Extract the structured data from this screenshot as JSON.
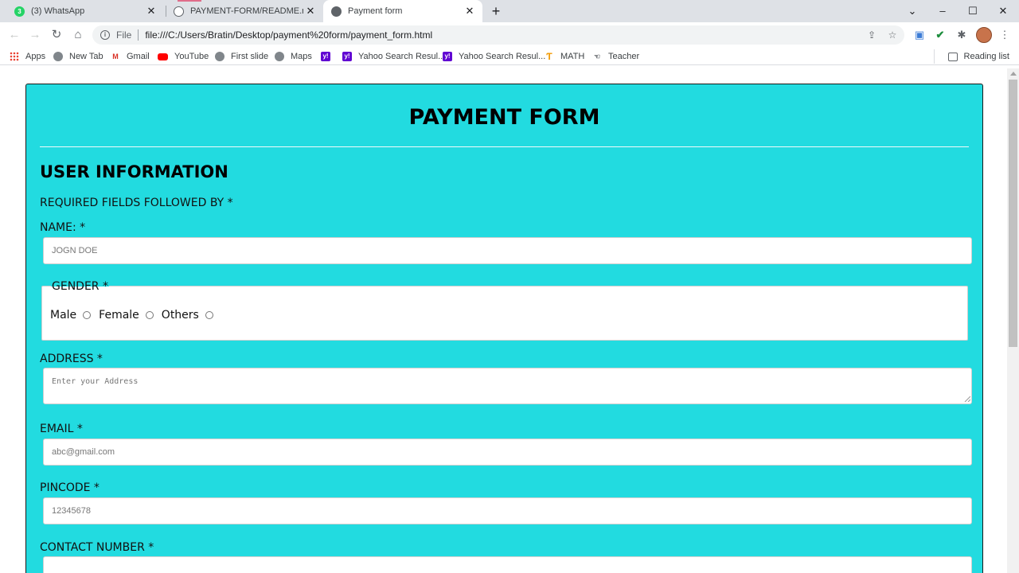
{
  "browser": {
    "tabs": [
      {
        "title": "(3) WhatsApp",
        "badge": "3",
        "active": false
      },
      {
        "title": "PAYMENT-FORM/README.md at",
        "active": false
      },
      {
        "title": "Payment form",
        "active": true
      }
    ],
    "new_tab_label": "+",
    "omnibox": {
      "scheme": "File",
      "url": "file:///C:/Users/Bratin/Desktop/payment%20form/payment_form.html"
    },
    "bookmarks": [
      {
        "label": "Apps",
        "icon": "apps-grid-icon"
      },
      {
        "label": "New Tab",
        "icon": "globe-icon"
      },
      {
        "label": "Gmail",
        "icon": "gmail-icon"
      },
      {
        "label": "YouTube",
        "icon": "youtube-icon"
      },
      {
        "label": "First slide",
        "icon": "globe-icon"
      },
      {
        "label": "Maps",
        "icon": "globe-icon"
      },
      {
        "label": "",
        "icon": "yahoo-icon"
      },
      {
        "label": "Yahoo Search Resul...",
        "icon": "yahoo-icon"
      },
      {
        "label": "Yahoo Search Resul...",
        "icon": "yahoo-icon"
      },
      {
        "label": "MATH",
        "icon": "math-icon"
      },
      {
        "label": "Teacher",
        "icon": "teacher-icon"
      }
    ],
    "reading_list": "Reading list"
  },
  "form": {
    "title": "PAYMENT FORM",
    "section_title": "USER INFORMATION",
    "required_note": "REQUIRED FIELDS FOLLOWED BY *",
    "name": {
      "label": "NAME: *",
      "placeholder": "JOGN DOE"
    },
    "gender": {
      "legend": "GENDER *",
      "options": [
        "Male",
        "Female",
        "Others"
      ]
    },
    "address": {
      "label": "ADDRESS *",
      "placeholder": "Enter your Address"
    },
    "email": {
      "label": "EMAIL *",
      "placeholder": "abc@gmail.com"
    },
    "pincode": {
      "label": "PINCODE *",
      "placeholder": "12345678"
    },
    "contact": {
      "label": "CONTACT NUMBER *",
      "placeholder": ""
    }
  },
  "colors": {
    "form_background": "#22dbe0",
    "tabstrip": "#dee1e6"
  }
}
